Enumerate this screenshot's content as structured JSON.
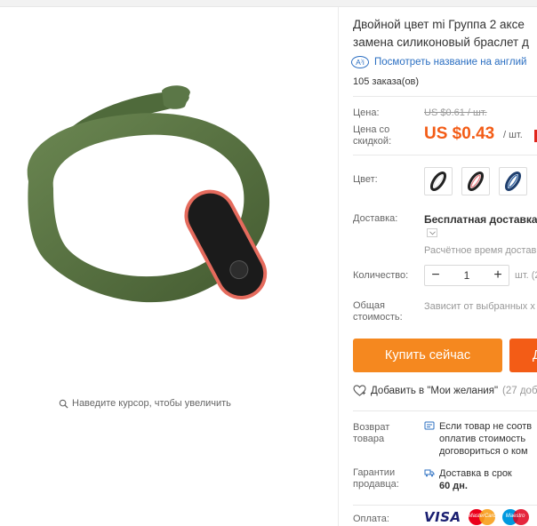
{
  "product": {
    "title_line1": "Двойной цвет mi Группа 2 аксе",
    "title_line2": "замена силиконовый браслет д",
    "translate_link": "Посмотреть название на англий",
    "orders": "105 заказа(ов)",
    "zoom_hint": "Наведите курсор, чтобы увеличить"
  },
  "price": {
    "label": "Цена:",
    "old": "US $0.61 / шт.",
    "discount_label": "Цена со скидкой:",
    "new": "US $0.43",
    "unit": "/ шт."
  },
  "color": {
    "label": "Цвет:",
    "swatches": [
      {
        "name": "black-white",
        "accent": "#e8e8e8"
      },
      {
        "name": "black-pink",
        "accent": "#e9868a"
      },
      {
        "name": "black-blue",
        "accent": "#3b6aa6"
      }
    ]
  },
  "delivery": {
    "label": "Доставка:",
    "value": "Бесплатная доставка в",
    "eta": "Расчётное время достав"
  },
  "quantity": {
    "label": "Количество:",
    "value": "1",
    "minus": "−",
    "plus": "+",
    "unit": "шт. (2"
  },
  "total": {
    "label": "Общая стоимость:",
    "value": "Зависит от выбранных х"
  },
  "actions": {
    "buy": "Купить сейчас",
    "cart": "Д"
  },
  "wishlist": {
    "label": "Добавить в \"Мои желания\"",
    "count": "(27 доб"
  },
  "return": {
    "label": "Возврат товара",
    "line1": "Если товар не соотв",
    "line2": "оплатив стоимость",
    "line3": "договориться о ком"
  },
  "guarantee": {
    "label": "Гарантии продавца:",
    "line1": "Доставка в срок",
    "line2": "60 дн."
  },
  "payment": {
    "label": "Оплата:",
    "visa": "VISA",
    "mastercard": "MasterCard",
    "maestro": "Maestro"
  },
  "colors": {
    "accent_orange": "#f5881f",
    "price_orange": "#f35c16",
    "link_blue": "#2b6fc2",
    "band_green": "#55703f"
  }
}
